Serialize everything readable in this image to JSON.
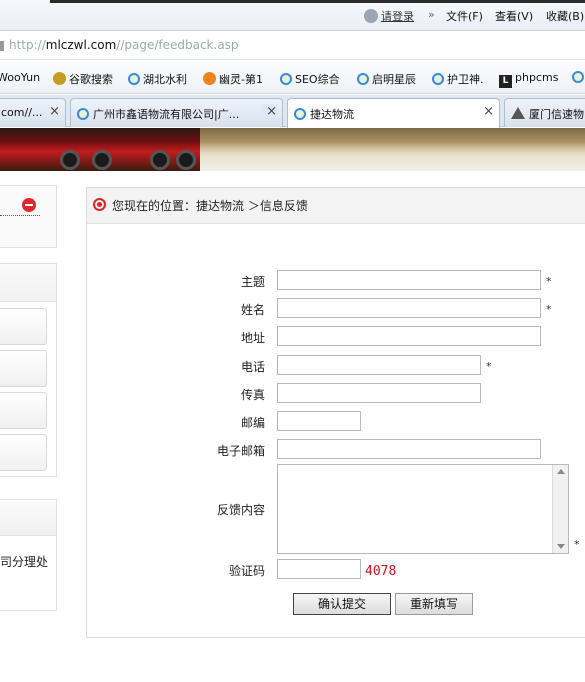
{
  "browser": {
    "login": "请登录",
    "chevron": "»",
    "menu": {
      "file": "文件(F)",
      "view": "查看(V)",
      "favorites": "收藏(B)"
    },
    "address": {
      "prefix": "http://",
      "host": "mlczwl.com",
      "path": "//page/feedback.asp"
    },
    "bookmarks": [
      {
        "label": "WooYun"
      },
      {
        "label": "谷歌搜索",
        "icon": "paw-icon"
      },
      {
        "label": "湖北水利",
        "icon": "ie-icon"
      },
      {
        "label": "幽灵-第1",
        "icon": "smile-icon"
      },
      {
        "label": "SEO综合",
        "icon": "ie-icon"
      },
      {
        "label": "启明星辰",
        "icon": "ie-icon"
      },
      {
        "label": "护卫神.",
        "icon": "ie-icon"
      },
      {
        "label": "phpcms",
        "icon": "letter-l-icon"
      }
    ],
    "tabs": [
      {
        "label": "com//...",
        "active": false
      },
      {
        "label": "广州市鑫语物流有限公司|广...",
        "active": false
      },
      {
        "label": "捷达物流",
        "active": true
      },
      {
        "label": "厦门信速物",
        "active": false
      }
    ],
    "tab_close": "×"
  },
  "sidebar": {
    "branch_text": "司分理处"
  },
  "breadcrumb": {
    "text": "您现在的位置：捷达物流 ＞信息反馈"
  },
  "form": {
    "subject_label": "主题",
    "name_label": "姓名",
    "address_label": "地址",
    "phone_label": "电话",
    "fax_label": "传真",
    "postcode_label": "邮编",
    "email_label": "电子邮箱",
    "content_label": "反馈内容",
    "captcha_label": "验证码",
    "captcha_value": "4078",
    "required_mark": "*",
    "submit_label": "确认提交",
    "reset_label": "重新填写"
  }
}
